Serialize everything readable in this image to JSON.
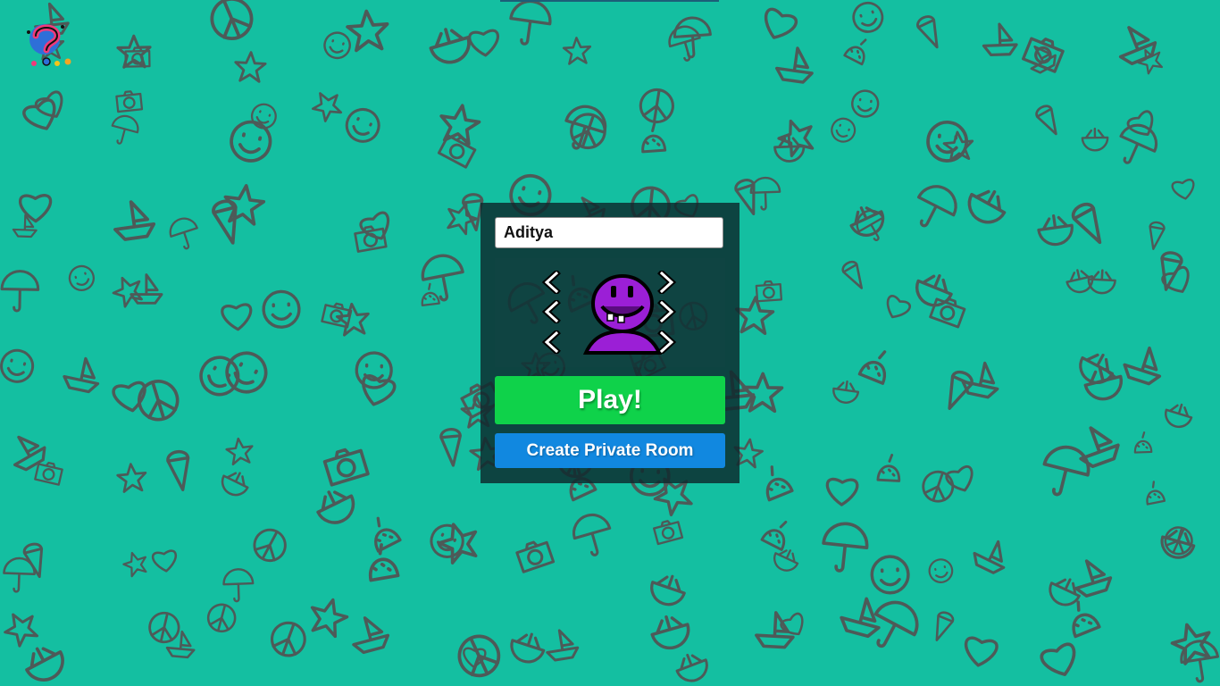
{
  "colors": {
    "background": "#14bfa1",
    "doodle": "#4d5a58",
    "panel": "#0c282c",
    "play_button": "#0fd24a",
    "private_button": "#1188e0",
    "avatar": "#9b1fd6"
  },
  "logo": {
    "icon": "question-mark-logo-icon"
  },
  "login": {
    "name_value": "Aditya"
  },
  "avatar_selector": {
    "rows": [
      "eyes",
      "mouth",
      "color"
    ],
    "left_icon": "chevron-left-icon",
    "right_icon": "chevron-right-icon",
    "avatar_icon": "purple-avatar-icon"
  },
  "buttons": {
    "play_label": "Play!",
    "private_label": "Create Private Room"
  }
}
